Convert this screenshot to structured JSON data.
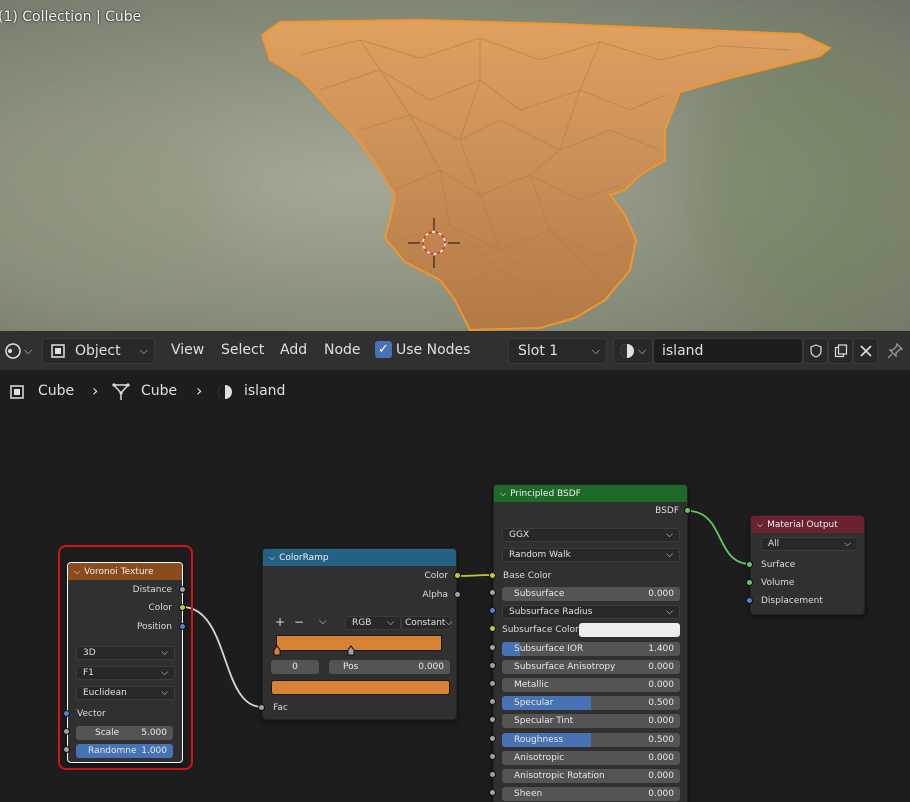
{
  "viewport": {
    "label": "(1) Collection | Cube"
  },
  "header": {
    "editor_type_icon": "node-editor-icon",
    "mode": "Object",
    "menus": [
      "View",
      "Select",
      "Add",
      "Node"
    ],
    "use_nodes_label": "Use Nodes",
    "use_nodes_checked": true,
    "slot": "Slot 1",
    "material_name": "island"
  },
  "breadcrumb": {
    "items": [
      "Cube",
      "Cube",
      "island"
    ]
  },
  "nodes": {
    "voronoi": {
      "title": "Voronoi Texture",
      "outputs": [
        "Distance",
        "Color",
        "Position"
      ],
      "dim": "3D",
      "feature": "F1",
      "metric": "Euclidean",
      "vector_label": "Vector",
      "scale_label": "Scale",
      "scale_value": "5.000",
      "random_label": "Randomne",
      "random_value": "1.000"
    },
    "colorramp": {
      "title": "ColorRamp",
      "outputs": [
        "Color",
        "Alpha"
      ],
      "plus": "+",
      "minus": "−",
      "dropdown": "⌵",
      "color_mode": "RGB",
      "interp": "Constant",
      "stop_index": "0",
      "pos_label": "Pos",
      "pos_value": "0.000",
      "ramp_color": "#d88236",
      "fac_label": "Fac"
    },
    "bsdf": {
      "title": "Principled BSDF",
      "output": "BSDF",
      "distribution": "GGX",
      "subsurface_method": "Random Walk",
      "base_color_label": "Base Color",
      "fields": [
        {
          "label": "Subsurface",
          "value": "0.000",
          "fill": 0
        },
        {
          "label": "Subsurface Radius",
          "value": "",
          "fill": 0
        },
        {
          "label": "Subsurface Color",
          "value": "",
          "fill": 0
        },
        {
          "label": "Subsurface IOR",
          "value": "1.400",
          "fill": 0.1
        },
        {
          "label": "Subsurface Anisotropy",
          "value": "0.000",
          "fill": 0
        },
        {
          "label": "Metallic",
          "value": "0.000",
          "fill": 0
        },
        {
          "label": "Specular",
          "value": "0.500",
          "fill": 0.5
        },
        {
          "label": "Specular Tint",
          "value": "0.000",
          "fill": 0
        },
        {
          "label": "Roughness",
          "value": "0.500",
          "fill": 0.5
        },
        {
          "label": "Anisotropic",
          "value": "0.000",
          "fill": 0
        },
        {
          "label": "Anisotropic Rotation",
          "value": "0.000",
          "fill": 0
        },
        {
          "label": "Sheen",
          "value": "0.000",
          "fill": 0
        }
      ]
    },
    "output": {
      "title": "Material Output",
      "target": "All",
      "inputs": [
        "Surface",
        "Volume",
        "Displacement"
      ]
    }
  },
  "colors": {
    "accent": "#4772b3",
    "selection": "#d01418",
    "texture_header": "#8a4b1f",
    "converter_header": "#246283",
    "shader_header": "#1e6b29",
    "output_header": "#6b2130"
  }
}
